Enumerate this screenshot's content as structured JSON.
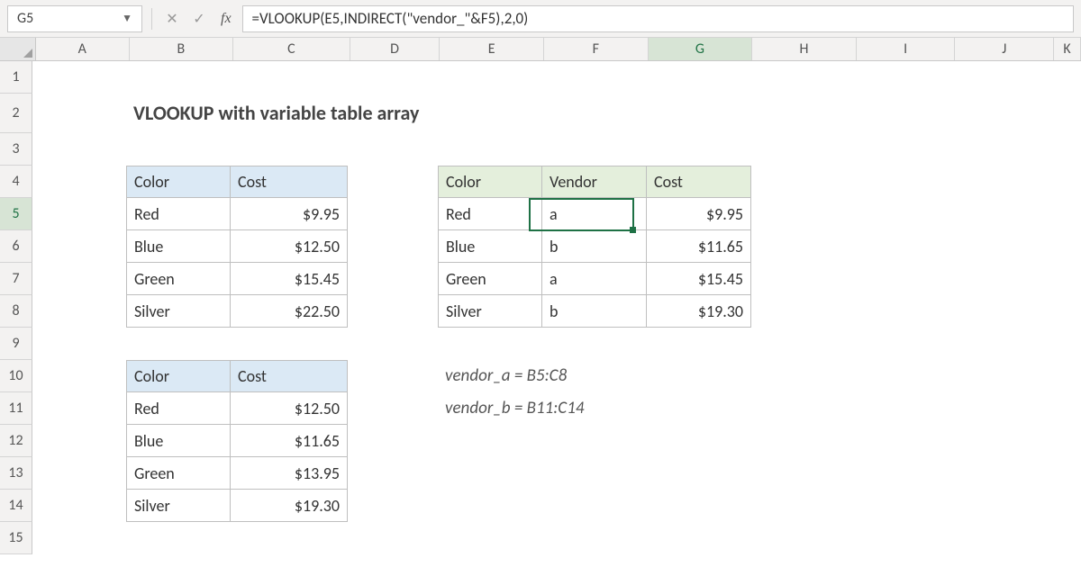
{
  "name_box": "G5",
  "formula": "=VLOOKUP(E5,INDIRECT(\"vendor_\"&F5),2,0)",
  "columns": [
    "A",
    "B",
    "C",
    "D",
    "E",
    "F",
    "G",
    "H",
    "I",
    "J",
    "K"
  ],
  "active_col": "G",
  "rows": [
    "1",
    "2",
    "3",
    "4",
    "5",
    "6",
    "7",
    "8",
    "9",
    "10",
    "11",
    "12",
    "13",
    "14",
    "15"
  ],
  "active_row": "5",
  "title": "VLOOKUP with variable table array",
  "table_a": {
    "headers": [
      "Color",
      "Cost"
    ],
    "rows": [
      [
        "Red",
        "$9.95"
      ],
      [
        "Blue",
        "$12.50"
      ],
      [
        "Green",
        "$15.45"
      ],
      [
        "Silver",
        "$22.50"
      ]
    ]
  },
  "table_b": {
    "headers": [
      "Color",
      "Cost"
    ],
    "rows": [
      [
        "Red",
        "$12.50"
      ],
      [
        "Blue",
        "$11.65"
      ],
      [
        "Green",
        "$13.95"
      ],
      [
        "Silver",
        "$19.30"
      ]
    ]
  },
  "table_result": {
    "headers": [
      "Color",
      "Vendor",
      "Cost"
    ],
    "rows": [
      [
        "Red",
        "a",
        "$9.95"
      ],
      [
        "Blue",
        "b",
        "$11.65"
      ],
      [
        "Green",
        "a",
        "$15.45"
      ],
      [
        "Silver",
        "b",
        "$19.30"
      ]
    ]
  },
  "notes": {
    "line1": "vendor_a = B5:C8",
    "line2": "vendor_b = B11:C14"
  }
}
